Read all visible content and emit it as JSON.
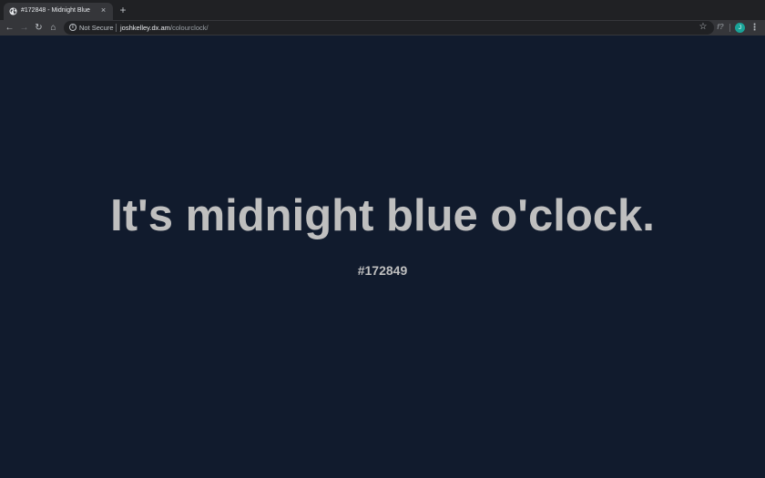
{
  "browser": {
    "tab": {
      "title": "#172848 - Midnight Blue",
      "close_glyph": "×",
      "favicon": "globe-icon"
    },
    "new_tab_glyph": "+",
    "toolbar": {
      "back_glyph": "←",
      "forward_glyph": "→",
      "reload_glyph": "↻",
      "home_glyph": "⌂",
      "security_glyph": "i",
      "security_label": "Not Secure",
      "url_host": "joshkelley.dx.am",
      "url_path": "/colourclock/",
      "star_glyph": "☆",
      "extension_glyph": "f?",
      "avatar_letter": "J",
      "menu_glyph": "⋮"
    }
  },
  "page": {
    "headline": "It's midnight blue o'clock.",
    "hex_code": "#172849",
    "background_color": "#111b2d",
    "text_color": "#bfbfbf"
  }
}
